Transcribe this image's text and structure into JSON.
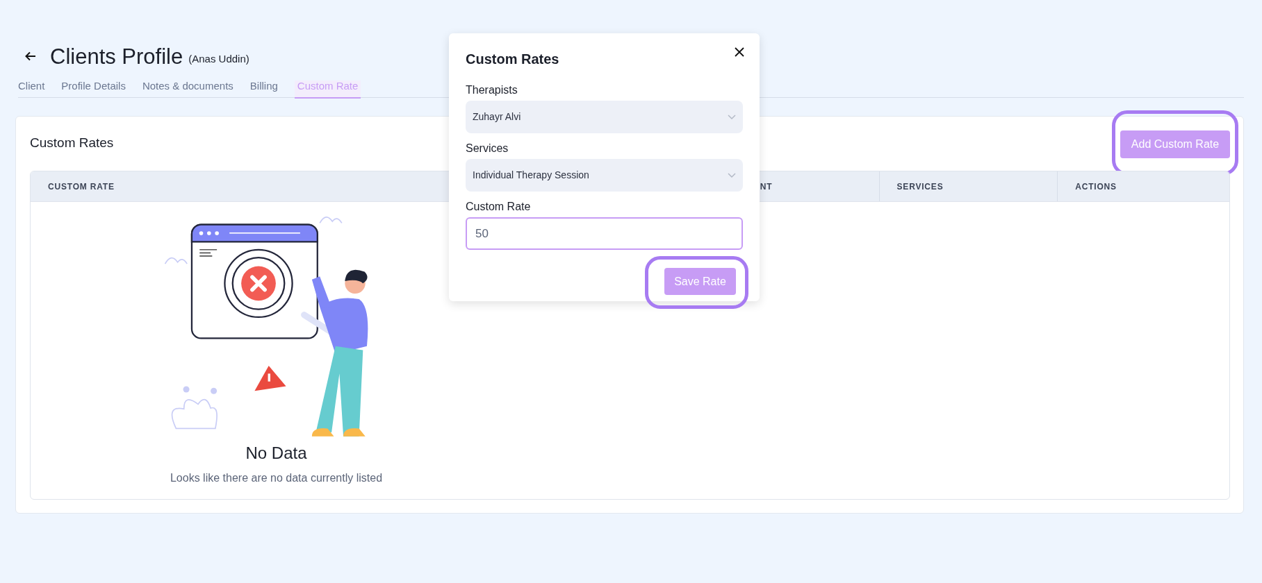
{
  "page": {
    "title": "Clients Profile",
    "subtitle": "(Anas Uddin)"
  },
  "tabs": [
    {
      "label": "Client",
      "selected": false
    },
    {
      "label": "Profile Details",
      "selected": false
    },
    {
      "label": "Notes & documents",
      "selected": false
    },
    {
      "label": "Billing",
      "selected": false
    },
    {
      "label": "Custom Rate",
      "selected": true
    }
  ],
  "card": {
    "title": "Custom Rates",
    "add_button": {
      "label": "Add Custom Rate",
      "highlighted": true
    }
  },
  "table": {
    "columns": [
      "CUSTOM RATE",
      "NT",
      "SERVICES",
      "ACTIONS"
    ],
    "empty_state": {
      "title": "No Data",
      "message": "Looks like there are no data currently listed"
    }
  },
  "modal": {
    "title": "Custom Rates",
    "fields": [
      {
        "kind": "select",
        "label": "Therapists",
        "value": "Zuhayr Alvi"
      },
      {
        "kind": "select",
        "label": "Services",
        "value": "Individual Therapy Session"
      },
      {
        "kind": "input",
        "label": "Custom Rate",
        "value": "50",
        "focused": true
      }
    ],
    "save_button": {
      "label": "Save Rate",
      "highlighted": true
    }
  }
}
